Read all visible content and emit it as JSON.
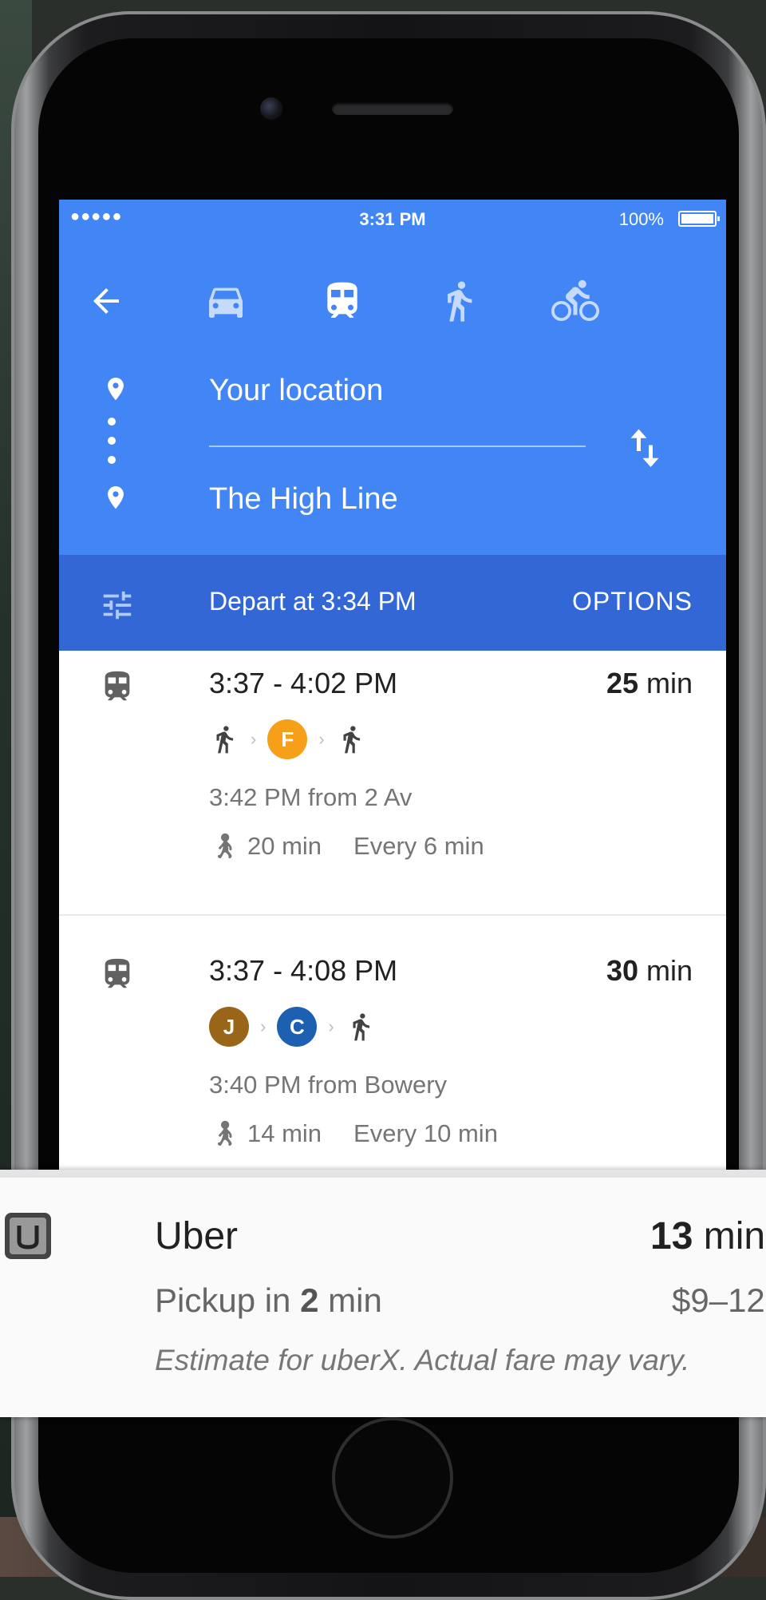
{
  "status_bar": {
    "signal": "●●●●●",
    "time": "3:31 PM",
    "battery": "100%"
  },
  "modes": [
    {
      "name": "driving",
      "icon": "car-icon"
    },
    {
      "name": "transit",
      "icon": "train-icon",
      "selected": true
    },
    {
      "name": "walking",
      "icon": "walking-icon"
    },
    {
      "name": "cycling",
      "icon": "bicycle-icon"
    }
  ],
  "origin": "Your location",
  "destination": "The High Line",
  "depart_bar": {
    "text": "Depart at 3:34 PM",
    "options_label": "OPTIONS"
  },
  "routes": [
    {
      "times": "3:37 - 4:02 PM",
      "duration_num": "25",
      "duration_unit": " min",
      "lines": [
        {
          "label": "F",
          "color": "#f6a01a"
        }
      ],
      "from": "3:42 PM from 2 Av",
      "walk": "20 min",
      "frequency": "Every 6 min"
    },
    {
      "times": "3:37 - 4:08 PM",
      "duration_num": "30",
      "duration_unit": " min",
      "lines": [
        {
          "label": "J",
          "color": "#996619"
        },
        {
          "label": "C",
          "color": "#1d5fb1"
        }
      ],
      "from": "3:40 PM from Bowery",
      "walk": "14 min",
      "frequency": "Every 10 min"
    }
  ],
  "uber": {
    "title": "Uber",
    "duration_num": "13",
    "duration_unit": " min",
    "pickup_prefix": "Pickup in ",
    "pickup_num": "2",
    "pickup_suffix": " min",
    "price": "$9–12",
    "note": "Estimate for uberX. Actual fare may vary."
  },
  "colors": {
    "header": "#4285f4",
    "depart_bar": "#3367d6"
  }
}
